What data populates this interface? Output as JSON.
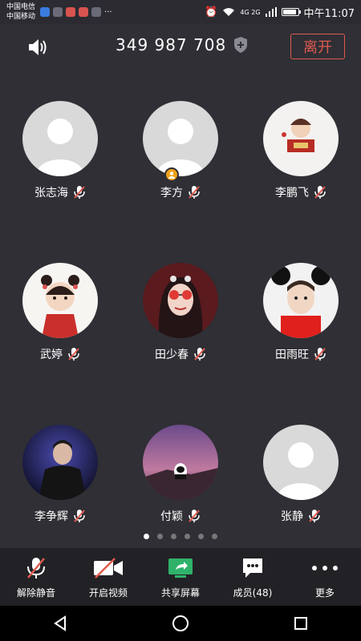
{
  "status_bar": {
    "carrier_1": "中国电信",
    "carrier_2": "中国移动",
    "network": "4G 2G",
    "time": "中午11:07"
  },
  "meeting": {
    "id": "349 987 708",
    "leave_label": "离开"
  },
  "participants": [
    {
      "name": "张志海",
      "avatar": "default",
      "muted": true
    },
    {
      "name": "李方",
      "avatar": "default",
      "muted": true,
      "host": true
    },
    {
      "name": "李鹏飞",
      "avatar": "cartoon-boy",
      "muted": true
    },
    {
      "name": "武婷",
      "avatar": "cartoon-girl",
      "muted": true
    },
    {
      "name": "田少春",
      "avatar": "girl-sunglasses",
      "muted": true
    },
    {
      "name": "田雨旺",
      "avatar": "boy-ears",
      "muted": true
    },
    {
      "name": "李争辉",
      "avatar": "man-photo",
      "muted": true
    },
    {
      "name": "付颖",
      "avatar": "panda-sunset",
      "muted": true
    },
    {
      "name": "张静",
      "avatar": "default",
      "muted": true
    }
  ],
  "pagination": {
    "pages": 6,
    "current": 1
  },
  "toolbar": {
    "unmute_label": "解除静音",
    "video_label": "开启视频",
    "share_label": "共享屏幕",
    "members_label": "成员(48)",
    "more_label": "更多"
  },
  "colors": {
    "background": "#2f2f35",
    "leave": "#e05a4f",
    "share_green": "#2fb26a",
    "mute_red": "#e05a4f",
    "host_badge": "#f0a21a"
  }
}
